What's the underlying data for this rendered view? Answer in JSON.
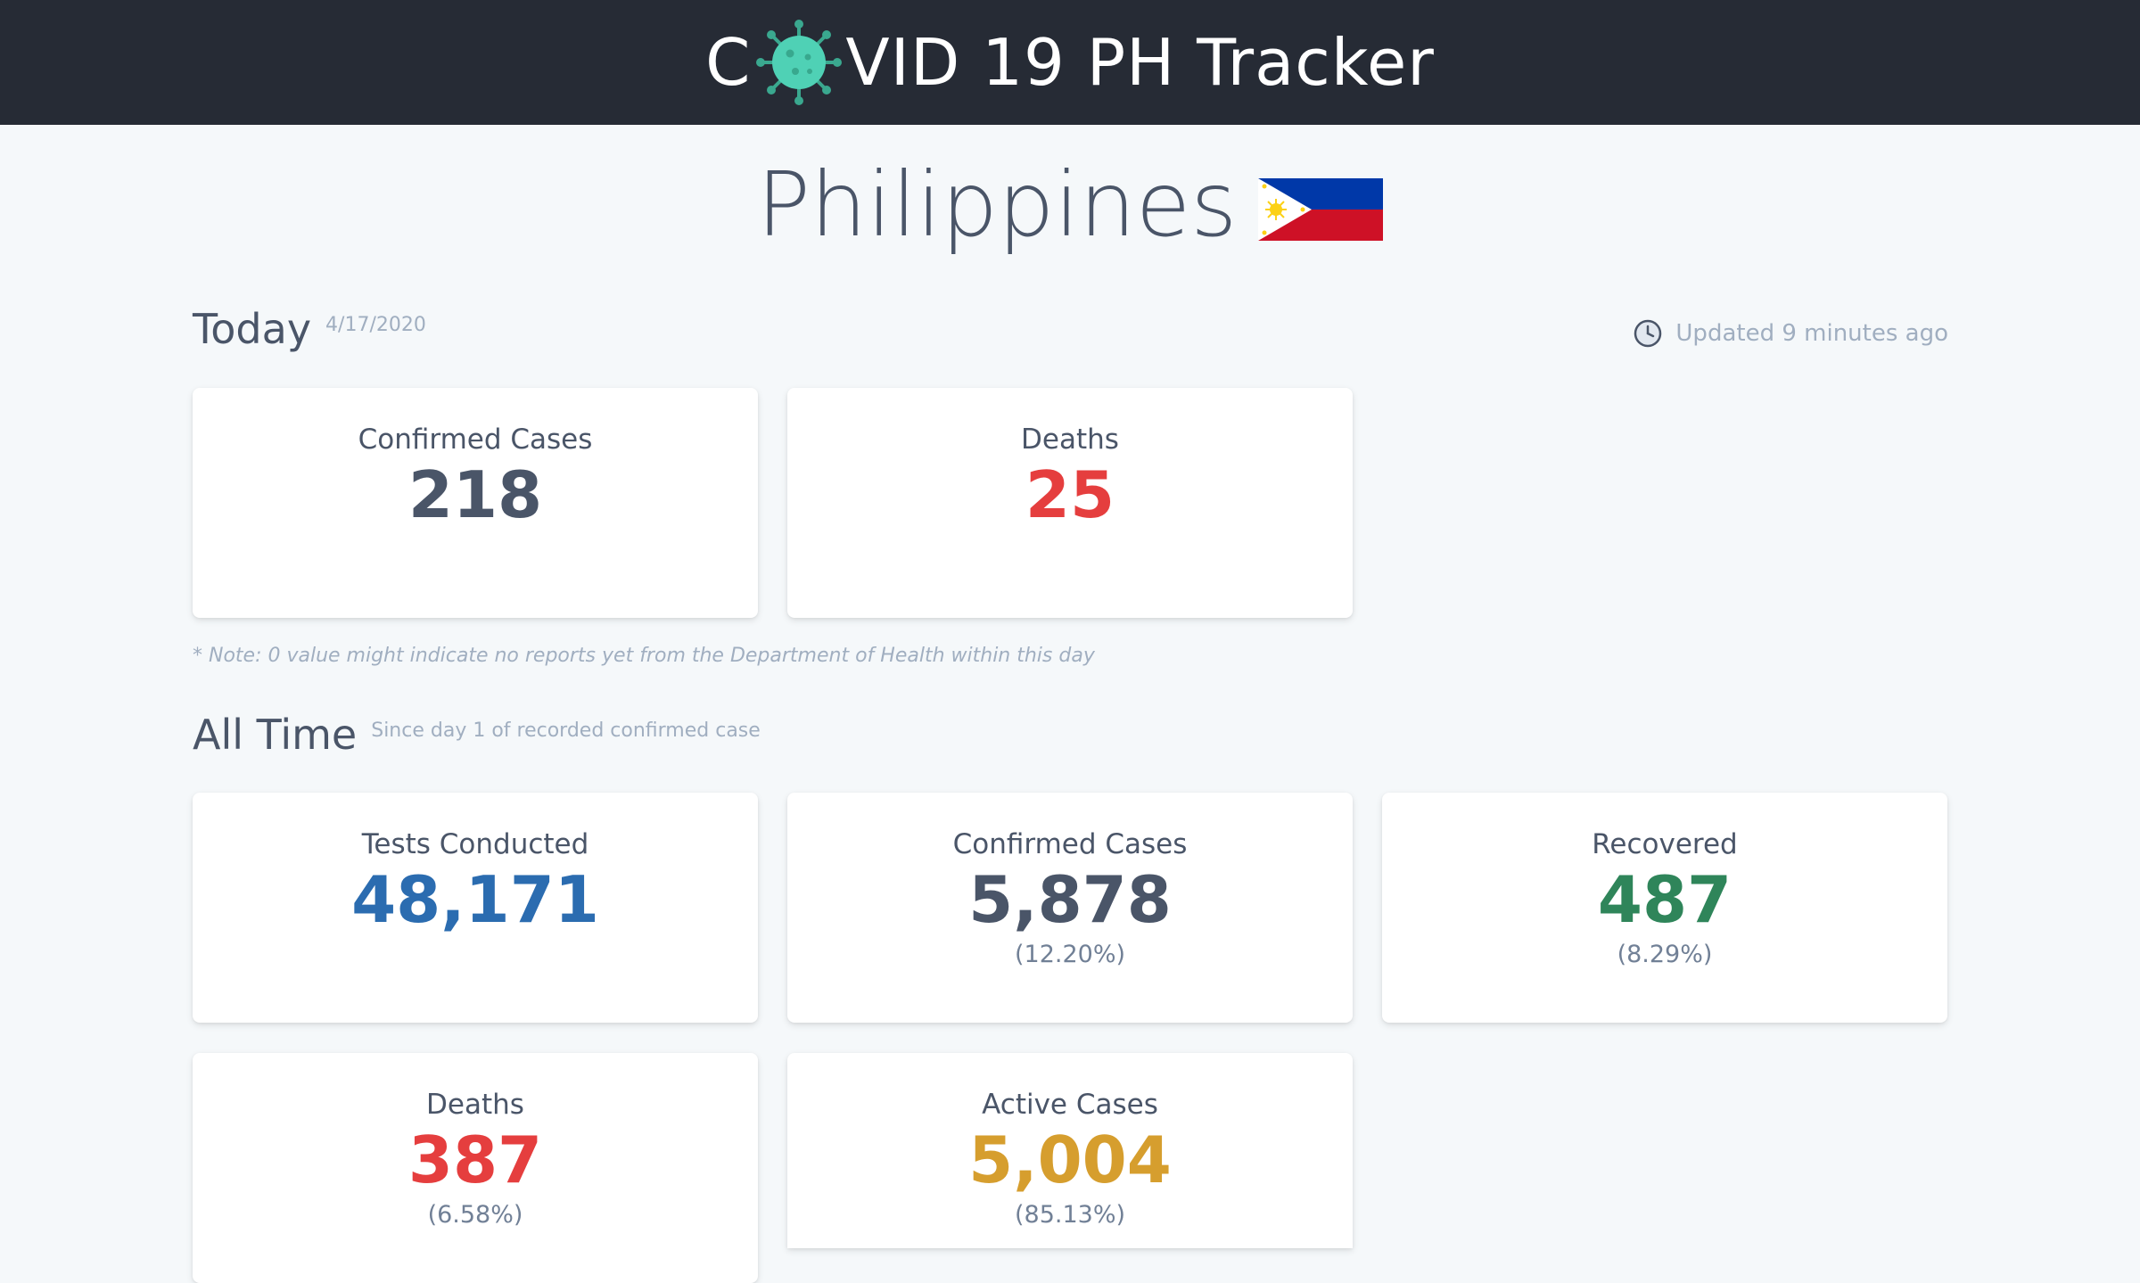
{
  "header": {
    "title_prefix": "C",
    "title_suffix": "VID 19 PH Tracker",
    "logo_icon": "virus-icon"
  },
  "country": {
    "name": "Philippines",
    "flag_icon": "philippines-flag"
  },
  "today": {
    "heading": "Today",
    "date": "4/17/2020",
    "updated": "Updated 9 minutes ago",
    "cards": [
      {
        "label": "Confirmed Cases",
        "value": "218"
      },
      {
        "label": "Deaths",
        "value": "25"
      }
    ],
    "note": "* Note: 0 value might indicate no reports yet from the Department of Health within this day"
  },
  "all_time": {
    "heading": "All Time",
    "subtitle": "Since day 1 of recorded confirmed case",
    "cards": [
      {
        "label": "Tests Conducted",
        "value": "48,171"
      },
      {
        "label": "Confirmed Cases",
        "value": "5,878",
        "pct": "(12.20%)"
      },
      {
        "label": "Recovered",
        "value": "487",
        "pct": "(8.29%)"
      },
      {
        "label": "Deaths",
        "value": "387",
        "pct": "(6.58%)"
      },
      {
        "label": "Active Cases",
        "value": "5,004",
        "pct": "(85.13%)"
      }
    ]
  },
  "colors": {
    "header_bg": "#262b35",
    "neutral": "#4a5568",
    "deaths": "#e53e3e",
    "tests": "#2b6cb0",
    "recovered": "#2f855a",
    "active": "#d69e2e",
    "virus": "#4fd1b5"
  }
}
